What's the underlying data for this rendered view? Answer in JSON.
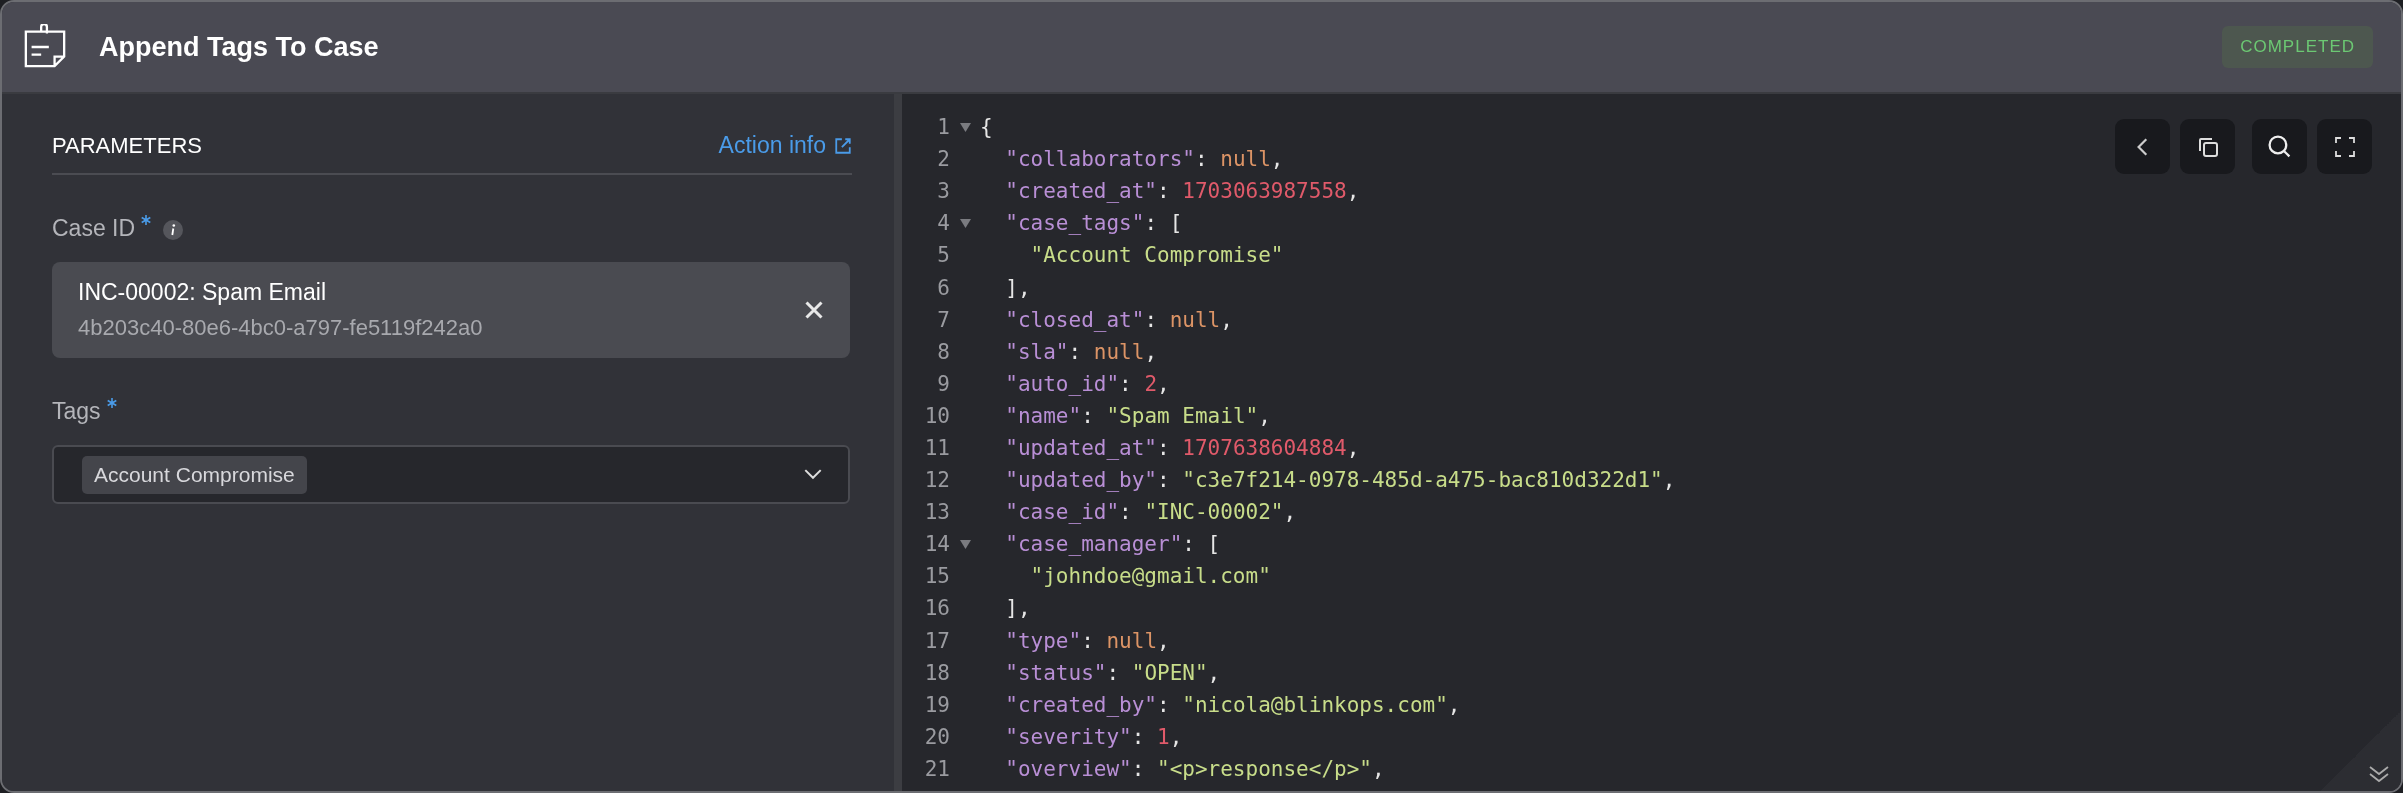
{
  "header": {
    "title": "Append Tags To Case",
    "status": "COMPLETED"
  },
  "parameters": {
    "heading": "PARAMETERS",
    "action_link": "Action info",
    "fields": [
      {
        "kind": "record",
        "label": "Case ID",
        "required": true,
        "has_info": true,
        "title": "INC-00002: Spam Email",
        "subtitle": "4b203c40-80e6-4bc0-a797-fe5119f242a0"
      },
      {
        "kind": "tags",
        "label": "Tags",
        "required": true,
        "tags": [
          "Account Compromise"
        ]
      }
    ]
  },
  "code": {
    "lines": [
      {
        "number": "1",
        "expanded": true,
        "tokens": [
          {
            "kind": "punct",
            "text": "{"
          }
        ]
      },
      {
        "number": "2",
        "tokens": [
          {
            "kind": "key",
            "text": "  \"collaborators\""
          },
          {
            "kind": "punct",
            "text": ": "
          },
          {
            "kind": "null",
            "text": "null"
          },
          {
            "kind": "punct",
            "text": ","
          }
        ]
      },
      {
        "number": "3",
        "tokens": [
          {
            "kind": "key",
            "text": "  \"created_at\""
          },
          {
            "kind": "punct",
            "text": ": "
          },
          {
            "kind": "number",
            "text": "1703063987558"
          },
          {
            "kind": "punct",
            "text": ","
          }
        ]
      },
      {
        "number": "4",
        "expanded": true,
        "tokens": [
          {
            "kind": "key",
            "text": "  \"case_tags\""
          },
          {
            "kind": "punct",
            "text": ": ["
          }
        ]
      },
      {
        "number": "5",
        "tokens": [
          {
            "kind": "string",
            "text": "    \"Account Compromise\""
          }
        ]
      },
      {
        "number": "6",
        "tokens": [
          {
            "kind": "punct",
            "text": "  ],"
          }
        ]
      },
      {
        "number": "7",
        "tokens": [
          {
            "kind": "key",
            "text": "  \"closed_at\""
          },
          {
            "kind": "punct",
            "text": ": "
          },
          {
            "kind": "null",
            "text": "null"
          },
          {
            "kind": "punct",
            "text": ","
          }
        ]
      },
      {
        "number": "8",
        "tokens": [
          {
            "kind": "key",
            "text": "  \"sla\""
          },
          {
            "kind": "punct",
            "text": ": "
          },
          {
            "kind": "null",
            "text": "null"
          },
          {
            "kind": "punct",
            "text": ","
          }
        ]
      },
      {
        "number": "9",
        "tokens": [
          {
            "kind": "key",
            "text": "  \"auto_id\""
          },
          {
            "kind": "punct",
            "text": ": "
          },
          {
            "kind": "number",
            "text": "2"
          },
          {
            "kind": "punct",
            "text": ","
          }
        ]
      },
      {
        "number": "10",
        "tokens": [
          {
            "kind": "key",
            "text": "  \"name\""
          },
          {
            "kind": "punct",
            "text": ": "
          },
          {
            "kind": "string",
            "text": "\"Spam Email\""
          },
          {
            "kind": "punct",
            "text": ","
          }
        ]
      },
      {
        "number": "11",
        "tokens": [
          {
            "kind": "key",
            "text": "  \"updated_at\""
          },
          {
            "kind": "punct",
            "text": ": "
          },
          {
            "kind": "number",
            "text": "1707638604884"
          },
          {
            "kind": "punct",
            "text": ","
          }
        ]
      },
      {
        "number": "12",
        "tokens": [
          {
            "kind": "key",
            "text": "  \"updated_by\""
          },
          {
            "kind": "punct",
            "text": ": "
          },
          {
            "kind": "string",
            "text": "\"c3e7f214-0978-485d-a475-bac810d322d1\""
          },
          {
            "kind": "punct",
            "text": ","
          }
        ]
      },
      {
        "number": "13",
        "tokens": [
          {
            "kind": "key",
            "text": "  \"case_id\""
          },
          {
            "kind": "punct",
            "text": ": "
          },
          {
            "kind": "string",
            "text": "\"INC-00002\""
          },
          {
            "kind": "punct",
            "text": ","
          }
        ]
      },
      {
        "number": "14",
        "expanded": true,
        "tokens": [
          {
            "kind": "key",
            "text": "  \"case_manager\""
          },
          {
            "kind": "punct",
            "text": ": ["
          }
        ]
      },
      {
        "number": "15",
        "tokens": [
          {
            "kind": "string",
            "text": "    \"johndoe@gmail.com\""
          }
        ]
      },
      {
        "number": "16",
        "tokens": [
          {
            "kind": "punct",
            "text": "  ],"
          }
        ]
      },
      {
        "number": "17",
        "tokens": [
          {
            "kind": "key",
            "text": "  \"type\""
          },
          {
            "kind": "punct",
            "text": ": "
          },
          {
            "kind": "null",
            "text": "null"
          },
          {
            "kind": "punct",
            "text": ","
          }
        ]
      },
      {
        "number": "18",
        "tokens": [
          {
            "kind": "key",
            "text": "  \"status\""
          },
          {
            "kind": "punct",
            "text": ": "
          },
          {
            "kind": "string",
            "text": "\"OPEN\""
          },
          {
            "kind": "punct",
            "text": ","
          }
        ]
      },
      {
        "number": "19",
        "tokens": [
          {
            "kind": "key",
            "text": "  \"created_by\""
          },
          {
            "kind": "punct",
            "text": ": "
          },
          {
            "kind": "string",
            "text": "\"nicola@blinkops.com\""
          },
          {
            "kind": "punct",
            "text": ","
          }
        ]
      },
      {
        "number": "20",
        "tokens": [
          {
            "kind": "key",
            "text": "  \"severity\""
          },
          {
            "kind": "punct",
            "text": ": "
          },
          {
            "kind": "number",
            "text": "1"
          },
          {
            "kind": "punct",
            "text": ","
          }
        ]
      },
      {
        "number": "21",
        "tokens": [
          {
            "kind": "key",
            "text": "  \"overview\""
          },
          {
            "kind": "punct",
            "text": ": "
          },
          {
            "kind": "string",
            "text": "\"<p>response</p>\""
          },
          {
            "kind": "punct",
            "text": ","
          }
        ]
      }
    ]
  }
}
